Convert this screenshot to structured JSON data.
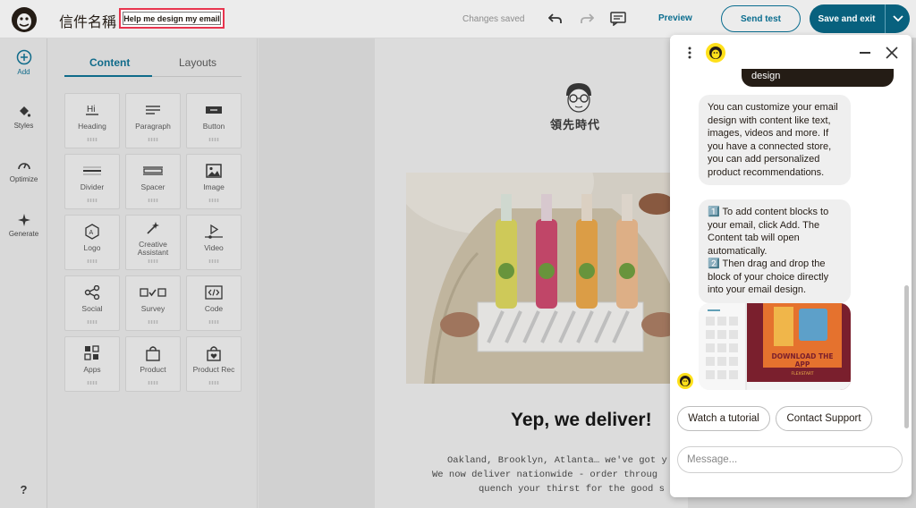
{
  "header": {
    "title": "信件名稱",
    "ai_button_label": "Help me design my email",
    "status": "Changes saved",
    "preview_label": "Preview",
    "send_test_label": "Send test",
    "save_exit_label": "Save and exit"
  },
  "rail": {
    "items": [
      {
        "label": "Add",
        "icon": "plus-circle-icon"
      },
      {
        "label": "Styles",
        "icon": "paint-bucket-icon"
      },
      {
        "label": "Optimize",
        "icon": "gauge-icon"
      },
      {
        "label": "Generate",
        "icon": "sparkle-icon"
      }
    ],
    "help_label": "?"
  },
  "panel": {
    "tabs": [
      {
        "label": "Content",
        "active": true
      },
      {
        "label": "Layouts",
        "active": false
      }
    ],
    "blocks": [
      {
        "label": "Heading",
        "icon": "heading-icon"
      },
      {
        "label": "Paragraph",
        "icon": "paragraph-icon"
      },
      {
        "label": "Button",
        "icon": "button-icon"
      },
      {
        "label": "Divider",
        "icon": "divider-icon"
      },
      {
        "label": "Spacer",
        "icon": "spacer-icon"
      },
      {
        "label": "Image",
        "icon": "image-icon"
      },
      {
        "label": "Logo",
        "icon": "logo-icon"
      },
      {
        "label": "Creative Assistant",
        "icon": "magic-wand-icon"
      },
      {
        "label": "Video",
        "icon": "video-icon"
      },
      {
        "label": "Social",
        "icon": "share-icon"
      },
      {
        "label": "Survey",
        "icon": "survey-icon"
      },
      {
        "label": "Code",
        "icon": "code-icon"
      },
      {
        "label": "Apps",
        "icon": "apps-icon"
      },
      {
        "label": "Product",
        "icon": "bag-icon"
      },
      {
        "label": "Product Rec",
        "icon": "bag-heart-icon"
      }
    ]
  },
  "email": {
    "brand": "領先時代",
    "headline": "Yep, we deliver!",
    "body_lines": [
      "Oakland, Brooklyn, Atlanta… we've got y",
      "We now deliver nationwide - order throug",
      "quench your thirst for the good s"
    ]
  },
  "chat": {
    "user_message_tail": "design",
    "bot_message_1": "You can customize your email design with content like text, images, videos and more. If you have a connected store, you can add personalized product recommendations.",
    "bot_message_2_line_1": "1️⃣ To add content blocks to your email, click Add. The Content tab will open automatically.",
    "bot_message_2_line_2": "2️⃣ Then drag and drop the block of your choice directly into your email design.",
    "image_caption": "DOWNLOAD THE APP",
    "image_footer": "FLEXSTART",
    "quick_replies": [
      "Watch a tutorial",
      "Contact Support"
    ],
    "input_placeholder": "Message..."
  },
  "colors": {
    "accent": "#0a6d8f",
    "primary_button": "#08617e",
    "highlight_border": "#e8344e",
    "mailchimp_yellow": "#ffe01b"
  }
}
